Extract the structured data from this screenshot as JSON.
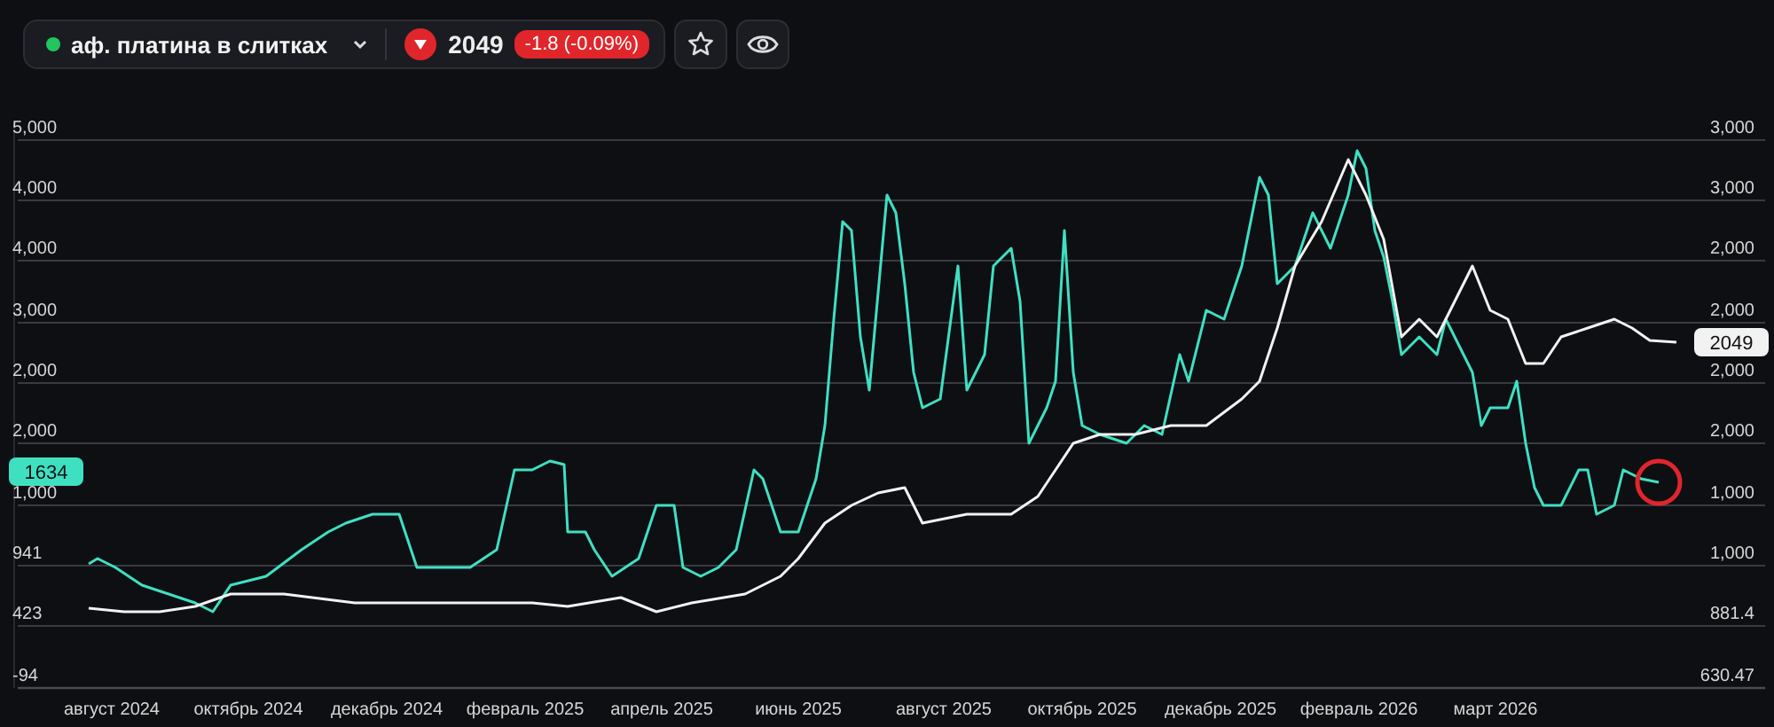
{
  "ticker": {
    "live": true,
    "name": "аф. платина в слитках",
    "down": true,
    "price": "2049",
    "change": "-1.8 (-0.09%)"
  },
  "chart": {
    "left_axis": [
      "5,000",
      "4,000",
      "4,000",
      "3,000",
      "2,000",
      "2,000",
      "1,000",
      "941",
      "423",
      "-94"
    ],
    "right_axis": [
      "3,000",
      "3,000",
      "2,000",
      "2,000",
      "2,000",
      "2,000",
      "1,000",
      "1,000",
      "881.4",
      "630.47"
    ],
    "x_axis": [
      "август 2024",
      "октябрь 2024",
      "декабрь 2024",
      "февраль 2025",
      "апрель 2025",
      "июнь 2025",
      "август 2025",
      "октябрь 2025",
      "декабрь 2025",
      "февраль 2026",
      "март 2026"
    ],
    "series": [
      {
        "color": "#3fe0c2",
        "badge": "1634",
        "left_axis": true
      },
      {
        "color": "#f2f2f2",
        "badge": "2049",
        "left_axis": false
      }
    ]
  }
}
